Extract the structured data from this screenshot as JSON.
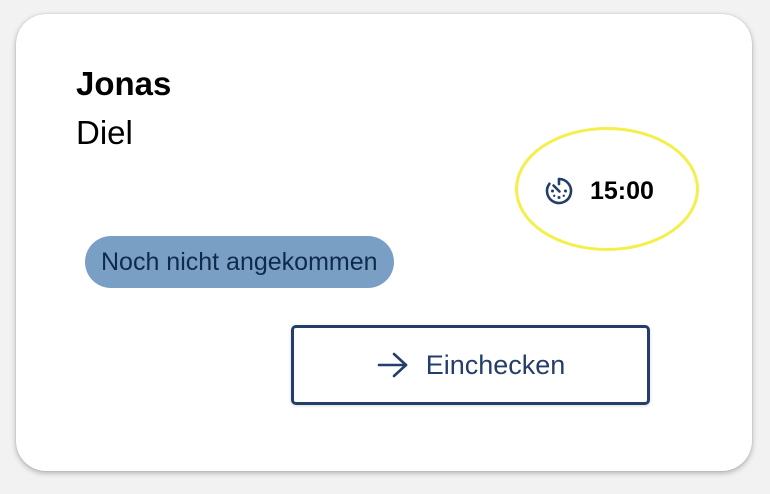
{
  "guest": {
    "first_name": "Jonas",
    "last_name": "Diel"
  },
  "appointment": {
    "time": "15:00",
    "icon": "timer-icon",
    "highlight_color": "#f4ef4a"
  },
  "status": {
    "label": "Noch nicht angekommen",
    "background": "#7a9fc4"
  },
  "action": {
    "checkin_label": "Einchecken",
    "icon": "arrow-right-icon",
    "accent": "#243e6b"
  }
}
